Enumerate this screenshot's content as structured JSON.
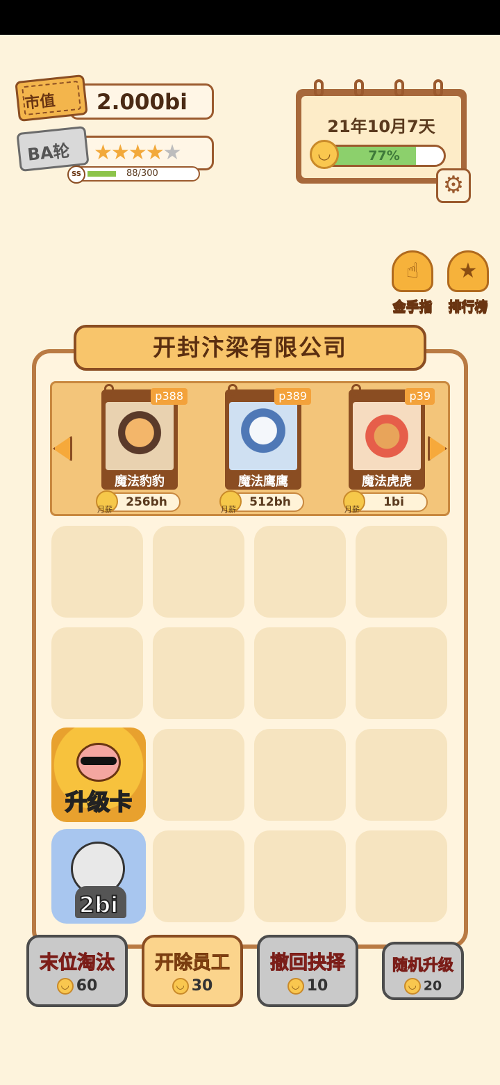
{
  "header": {
    "market_value_label": "市值",
    "market_value": "2.000bi",
    "round_label": "BA轮",
    "stars_filled": 4,
    "stars_total": 5,
    "level_badge": "SS",
    "xp_text": "88/300",
    "xp_current": 88,
    "xp_max": 300
  },
  "calendar": {
    "date": "21年10月7天",
    "mood_percent": "77%",
    "mood_value": 0.77
  },
  "side_buttons": {
    "gold_finger": "金手指",
    "leaderboard": "排行榜"
  },
  "company": {
    "name": "开封汴梁有限公司"
  },
  "hire_cards": [
    {
      "tag": "p388",
      "name": "魔法豹豹",
      "salary": "256bh",
      "salary_label": "月薪"
    },
    {
      "tag": "p389",
      "name": "魔法鹰鹰",
      "salary": "512bh",
      "salary_label": "月薪"
    },
    {
      "tag": "p39",
      "name": "魔法虎虎",
      "salary": "1bi",
      "salary_label": "月薪"
    }
  ],
  "grid_items": {
    "upgrade_card": "升级卡",
    "hamster": "2bi"
  },
  "actions": [
    {
      "label": "末位淘汰",
      "cost": "60"
    },
    {
      "label": "开除员工",
      "cost": "30"
    },
    {
      "label": "撤回抉择",
      "cost": "10"
    },
    {
      "label": "随机升级",
      "cost": "20"
    }
  ],
  "colors": {
    "background": "#fdf3dc",
    "accent": "#f3b54c",
    "border_brown": "#8a4d22"
  }
}
